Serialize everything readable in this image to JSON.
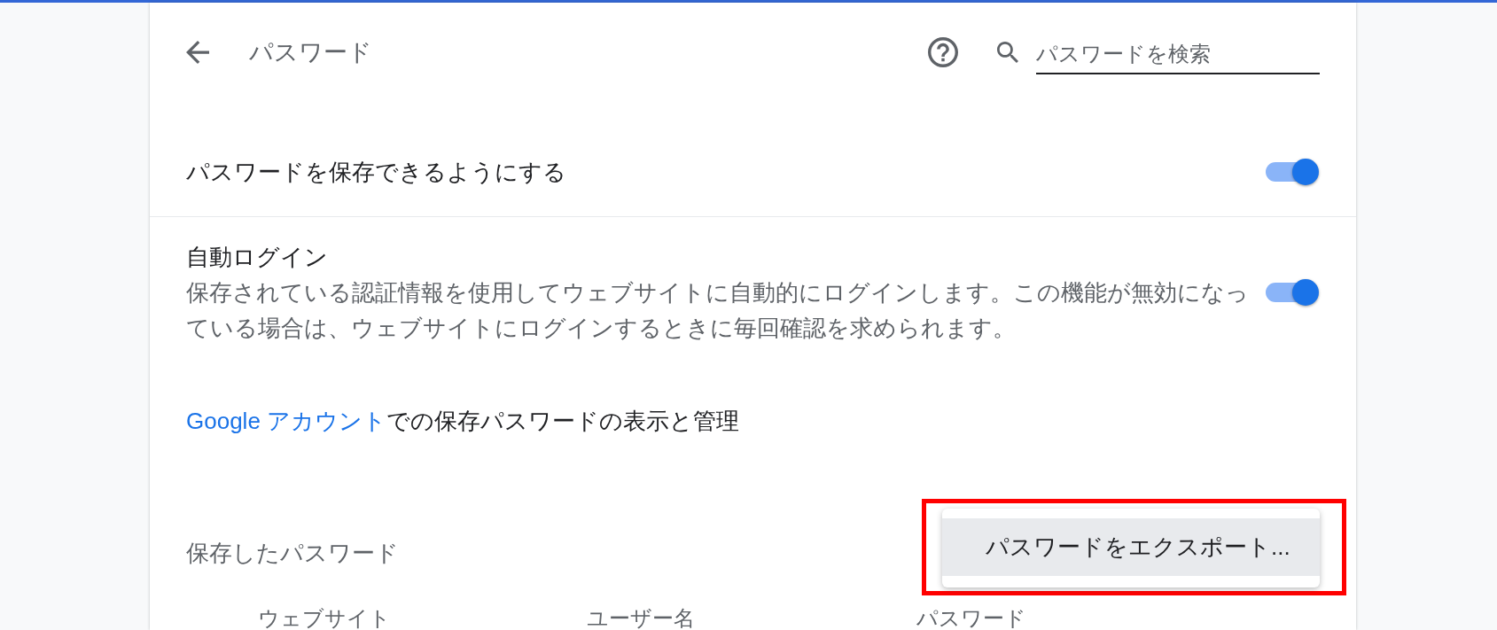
{
  "header": {
    "title": "パスワード",
    "search": {
      "placeholder": "パスワードを検索"
    }
  },
  "settings": [
    {
      "kind": "toggle",
      "label": "パスワードを保存できるようにする",
      "on": true
    },
    {
      "kind": "toggle",
      "label": "自動ログイン",
      "description": "保存されている認証情報を使用してウェブサイトに自動的にログインします。この機能が無効になっている場合は、ウェブサイトにログインするときに毎回確認を求められます。",
      "on": true
    }
  ],
  "account_link": {
    "link": "Google アカウント",
    "text": "での保存パスワードの表示と管理"
  },
  "saved_passwords": {
    "title": "保存したパスワード",
    "columns": [
      "ウェブサイト",
      "ユーザー名",
      "パスワード"
    ]
  },
  "menu": {
    "annotated": true,
    "items": [
      {
        "label": "パスワードをエクスポート...",
        "selected": true
      }
    ]
  }
}
